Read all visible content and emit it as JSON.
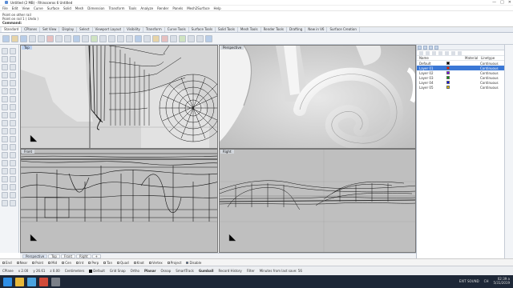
{
  "window": {
    "title": "Untitled (2 MB) - Rhinoceros 6 Untitled",
    "controls": [
      "—",
      "□",
      "✕"
    ]
  },
  "menu": [
    "File",
    "Edit",
    "View",
    "Curve",
    "Surface",
    "Solid",
    "Mesh",
    "Dimension",
    "Transform",
    "Tools",
    "Analyze",
    "Render",
    "Panels",
    "Mesh2Surface",
    "Help"
  ],
  "command_history": {
    "line1": "Point on other rail",
    "line2": "Point on rail 1 ( Undo )",
    "prompt": "Command:"
  },
  "toolbar_tabs": [
    "Standard",
    "CPlanes",
    "Set View",
    "Display",
    "Select",
    "Viewport Layout",
    "Visibility",
    "Transform",
    "Curve Tools",
    "Surface Tools",
    "Solid Tools",
    "Mesh Tools",
    "Render Tools",
    "Drafting",
    "New in V6",
    "Surface Creation"
  ],
  "viewports": {
    "top": "Top",
    "perspective": "Perspective",
    "front": "Front",
    "right": "Right"
  },
  "viewport_tabs": [
    "Perspective",
    "Top",
    "Front",
    "Right"
  ],
  "osnaps": [
    {
      "label": "End",
      "on": false
    },
    {
      "label": "Near",
      "on": false
    },
    {
      "label": "Point",
      "on": false
    },
    {
      "label": "Mid",
      "on": false
    },
    {
      "label": "Cen",
      "on": false
    },
    {
      "label": "Int",
      "on": false
    },
    {
      "label": "Perp",
      "on": false
    },
    {
      "label": "Tan",
      "on": false
    },
    {
      "label": "Quad",
      "on": false
    },
    {
      "label": "Knot",
      "on": false
    },
    {
      "label": "Vertex",
      "on": false
    },
    {
      "label": "Project",
      "on": false
    },
    {
      "label": "Disable",
      "on": true
    }
  ],
  "status": {
    "cplane": "CPlane",
    "x": "x 2.00",
    "y": "y 26.61",
    "z": "z 0.00",
    "units": "Centimeters",
    "layer": "Default",
    "grid_snap": "Grid Snap",
    "ortho": "Ortho",
    "planar": "Planar",
    "osnap": "Osnap",
    "smarttrack": "SmartTrack",
    "gumball": "Gumball",
    "record_history": "Record History",
    "filter": "Filter",
    "autosave": "Minutes from last save: 56"
  },
  "layers": {
    "headers": {
      "name": "Name",
      "material": "Material",
      "linetype": "Linetype"
    },
    "rows": [
      {
        "name": "Default",
        "linetype": "Continuous",
        "selected": false,
        "color": "#000000"
      },
      {
        "name": "Layer 01",
        "linetype": "Continuous",
        "selected": true,
        "color": "#ff0000"
      },
      {
        "name": "Layer 02",
        "linetype": "Continuous",
        "selected": false,
        "color": "#8000ff"
      },
      {
        "name": "Layer 03",
        "linetype": "Continuous",
        "selected": false,
        "color": "#00a000"
      },
      {
        "name": "Layer 04",
        "linetype": "Continuous",
        "selected": false,
        "color": "#0000ff"
      },
      {
        "name": "Layer 05",
        "linetype": "Continuous",
        "selected": false,
        "color": "#e0c000"
      }
    ]
  },
  "taskbar": {
    "tray_label": "EXIT SOUND",
    "lang": "CH",
    "time": "02:39 a",
    "date": "5/31/2019"
  },
  "colors": {
    "accent": "#3b78d6",
    "taskbar": "#1d2737",
    "viewport_bg": "#bfbfbf"
  }
}
